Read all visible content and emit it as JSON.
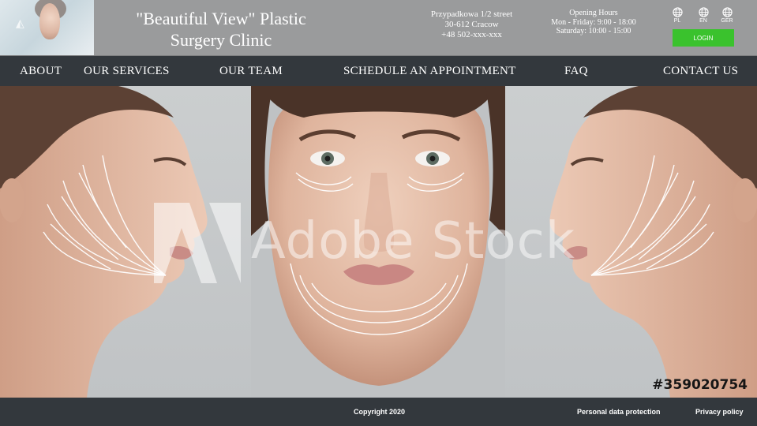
{
  "header": {
    "clinic_name_line1": "\"Beautiful View\" Plastic",
    "clinic_name_line2": "Surgery Clinic",
    "address_line1": "Przypadkowa 1/2 street",
    "address_line2": "30-612 Cracow",
    "address_line3": "+48 502-xxx-xxx",
    "hours_title": "Opening Hours",
    "hours_weekdays": "Mon - Friday: 9:00 - 18:00",
    "hours_saturday": "Saturday: 10:00 - 15:00",
    "languages": [
      {
        "code": "PL",
        "icon": "globe-icon"
      },
      {
        "code": "EN",
        "icon": "globe-icon"
      },
      {
        "code": "GER",
        "icon": "globe-icon"
      }
    ],
    "login_label": "LOGIN"
  },
  "nav": {
    "items": [
      "ABOUT",
      "OUR SERVICES",
      "OUR TEAM",
      "SCHEDULE AN APPOINTMENT",
      "FAQ",
      "CONTACT US"
    ]
  },
  "hero": {
    "watermark": "Adobe Stock",
    "stock_id": "#359020754"
  },
  "footer": {
    "copyright": "Copyright 2020",
    "data_protection": "Personal data protection",
    "privacy": "Privacy policy"
  },
  "colors": {
    "header_bg": "#9a9b9c",
    "nav_bg": "#33383d",
    "login_bg": "#3ac22d"
  }
}
